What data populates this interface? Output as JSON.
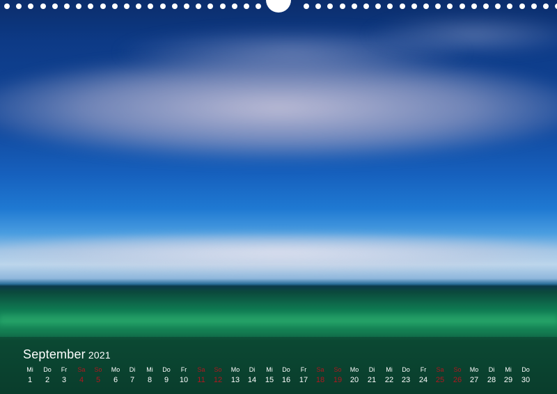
{
  "calendar": {
    "month": "September",
    "year": "2021",
    "days": [
      {
        "dow": "Mi",
        "num": "1",
        "weekend": false
      },
      {
        "dow": "Do",
        "num": "2",
        "weekend": false
      },
      {
        "dow": "Fr",
        "num": "3",
        "weekend": false
      },
      {
        "dow": "Sa",
        "num": "4",
        "weekend": true
      },
      {
        "dow": "So",
        "num": "5",
        "weekend": true
      },
      {
        "dow": "Mo",
        "num": "6",
        "weekend": false
      },
      {
        "dow": "Di",
        "num": "7",
        "weekend": false
      },
      {
        "dow": "Mi",
        "num": "8",
        "weekend": false
      },
      {
        "dow": "Do",
        "num": "9",
        "weekend": false
      },
      {
        "dow": "Fr",
        "num": "10",
        "weekend": false
      },
      {
        "dow": "Sa",
        "num": "11",
        "weekend": true
      },
      {
        "dow": "So",
        "num": "12",
        "weekend": true
      },
      {
        "dow": "Mo",
        "num": "13",
        "weekend": false
      },
      {
        "dow": "Di",
        "num": "14",
        "weekend": false
      },
      {
        "dow": "Mi",
        "num": "15",
        "weekend": false
      },
      {
        "dow": "Do",
        "num": "16",
        "weekend": false
      },
      {
        "dow": "Fr",
        "num": "17",
        "weekend": false
      },
      {
        "dow": "Sa",
        "num": "18",
        "weekend": true
      },
      {
        "dow": "So",
        "num": "19",
        "weekend": true
      },
      {
        "dow": "Mo",
        "num": "20",
        "weekend": false
      },
      {
        "dow": "Di",
        "num": "21",
        "weekend": false
      },
      {
        "dow": "Mi",
        "num": "22",
        "weekend": false
      },
      {
        "dow": "Do",
        "num": "23",
        "weekend": false
      },
      {
        "dow": "Fr",
        "num": "24",
        "weekend": false
      },
      {
        "dow": "Sa",
        "num": "25",
        "weekend": true
      },
      {
        "dow": "So",
        "num": "26",
        "weekend": true
      },
      {
        "dow": "Mo",
        "num": "27",
        "weekend": false
      },
      {
        "dow": "Di",
        "num": "28",
        "weekend": false
      },
      {
        "dow": "Mi",
        "num": "29",
        "weekend": false
      },
      {
        "dow": "Do",
        "num": "30",
        "weekend": false
      }
    ]
  },
  "colors": {
    "weekday_text": "#ffffff",
    "weekend_text": "#b2161e"
  }
}
